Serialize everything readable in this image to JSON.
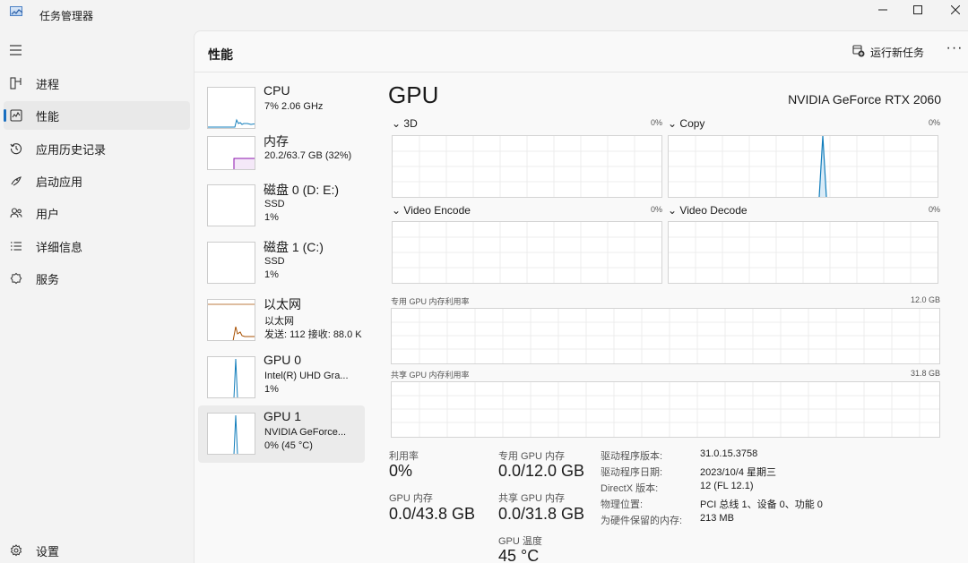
{
  "window": {
    "title": "任务管理器",
    "controls": {
      "minimize": "—",
      "maximize": "☐",
      "close": "✕"
    }
  },
  "sidebar": {
    "items": [
      {
        "label": "进程",
        "icon": "processes-icon"
      },
      {
        "label": "性能",
        "icon": "performance-icon",
        "active": true
      },
      {
        "label": "应用历史记录",
        "icon": "history-icon"
      },
      {
        "label": "启动应用",
        "icon": "startup-icon"
      },
      {
        "label": "用户",
        "icon": "users-icon"
      },
      {
        "label": "详细信息",
        "icon": "details-icon"
      },
      {
        "label": "服务",
        "icon": "services-icon"
      }
    ],
    "settings_label": "设置"
  },
  "header": {
    "title": "性能",
    "run_task_label": "运行新任务",
    "more_label": "···"
  },
  "devices": [
    {
      "name": "CPU",
      "sub1": "7% 2.06 GHz",
      "color": "#117dbb"
    },
    {
      "name": "内存",
      "sub1": "20.2/63.7 GB (32%)",
      "color": "#8b12ae"
    },
    {
      "name": "磁盘 0 (D: E:)",
      "sub1": "SSD",
      "sub2": "1%",
      "color": "#4da60c"
    },
    {
      "name": "磁盘 1 (C:)",
      "sub1": "SSD",
      "sub2": "1%",
      "color": "#4da60c"
    },
    {
      "name": "以太网",
      "sub1": "以太网",
      "sub2": "发送: 112 接收: 88.0 K",
      "color": "#a74f01"
    },
    {
      "name": "GPU 0",
      "sub1": "Intel(R) UHD Gra...",
      "sub2": "1%",
      "color": "#117dbb"
    },
    {
      "name": "GPU 1",
      "sub1": "NVIDIA GeForce...",
      "sub2": "0% (45 °C)",
      "color": "#117dbb",
      "active": true
    }
  ],
  "gpu": {
    "title": "GPU",
    "model": "NVIDIA GeForce RTX 2060",
    "engines": [
      {
        "label": "3D",
        "pct": "0%"
      },
      {
        "label": "Copy",
        "pct": "0%"
      },
      {
        "label": "Video Encode",
        "pct": "0%"
      },
      {
        "label": "Video Decode",
        "pct": "0%"
      }
    ],
    "dedicated_mem": {
      "label": "专用 GPU 内存利用率",
      "max": "12.0 GB"
    },
    "shared_mem": {
      "label": "共享 GPU 内存利用率",
      "max": "31.8 GB"
    },
    "stats": {
      "utilization_label": "利用率",
      "utilization": "0%",
      "dedicated_label": "专用 GPU 内存",
      "dedicated": "0.0/12.0 GB",
      "gpu_mem_label": "GPU 内存",
      "gpu_mem": "0.0/43.8 GB",
      "shared_label": "共享 GPU 内存",
      "shared": "0.0/31.8 GB",
      "temp_label": "GPU 温度",
      "temp": "45 °C"
    },
    "info": [
      {
        "k": "驱动程序版本:",
        "v": "31.0.15.3758"
      },
      {
        "k": "驱动程序日期:",
        "v": "2023/10/4 星期三"
      },
      {
        "k": "DirectX 版本:",
        "v": "12 (FL 12.1)"
      },
      {
        "k": "物理位置:",
        "v": "PCI 总线 1、设备 0、功能 0"
      },
      {
        "k": "为硬件保留的内存:",
        "v": "213 MB"
      }
    ]
  }
}
